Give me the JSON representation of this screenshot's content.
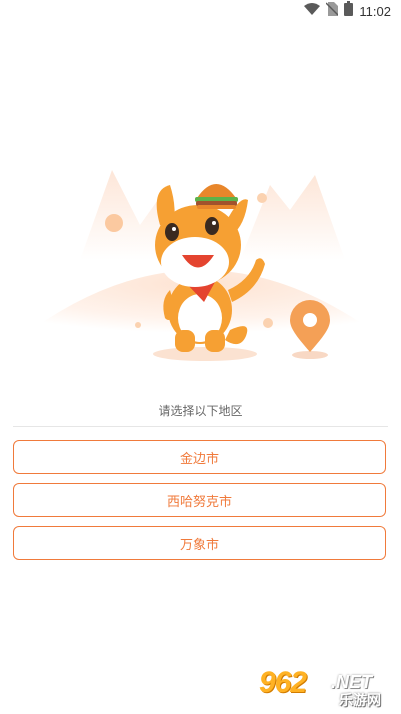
{
  "status_bar": {
    "time": "11:02",
    "icons": [
      "wifi-icon",
      "no-sim-icon",
      "battery-icon"
    ]
  },
  "colors": {
    "accent": "#f07a3b",
    "mascot_body": "#f6a033",
    "divider": "#e6e6e6"
  },
  "prompt": "请选择以下地区",
  "regions": [
    {
      "label": "金边市"
    },
    {
      "label": "西哈努克市"
    },
    {
      "label": "万象市"
    }
  ],
  "watermark": {
    "number": "962",
    "suffix": ".NET",
    "site_cn": "乐游网"
  }
}
